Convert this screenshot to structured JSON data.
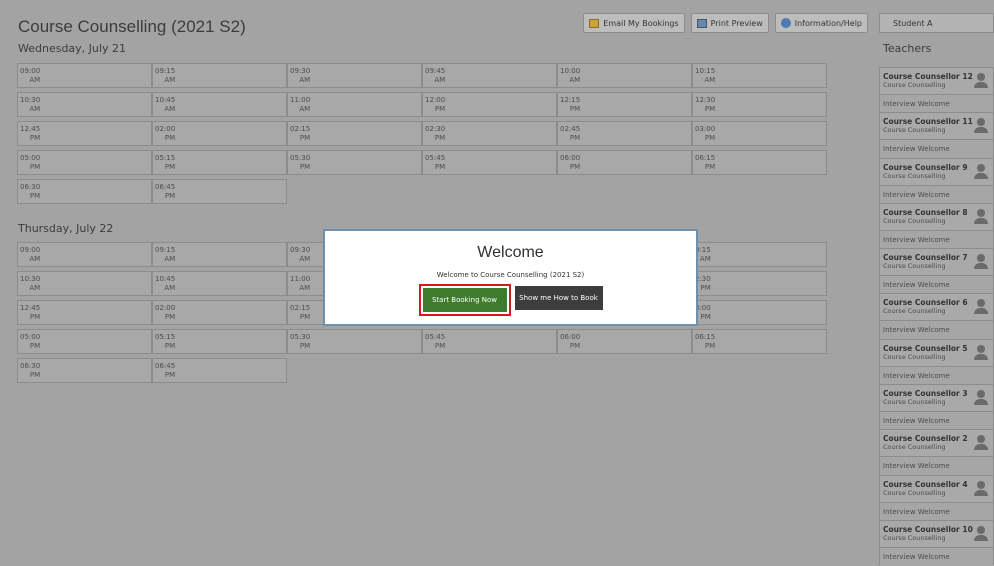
{
  "page": {
    "title": "Course Counselling (2021 S2)"
  },
  "toolbar": {
    "email_label": "Email My Bookings",
    "print_label": "Print Preview",
    "info_label": "Information/Help"
  },
  "user": {
    "name": "Student A"
  },
  "days": [
    {
      "heading": "Wednesday, July 21",
      "rows": [
        [
          {
            "t": "09:00",
            "p": "AM"
          },
          {
            "t": "09:15",
            "p": "AM"
          },
          {
            "t": "09:30",
            "p": "AM"
          },
          {
            "t": "09:45",
            "p": "AM"
          },
          {
            "t": "10:00",
            "p": "AM"
          },
          {
            "t": "10:15",
            "p": "AM"
          }
        ],
        [
          {
            "t": "10:30",
            "p": "AM"
          },
          {
            "t": "10:45",
            "p": "AM"
          },
          {
            "t": "11:00",
            "p": "AM"
          },
          {
            "t": "12:00",
            "p": "PM"
          },
          {
            "t": "12:15",
            "p": "PM"
          },
          {
            "t": "12:30",
            "p": "PM"
          }
        ],
        [
          {
            "t": "12:45",
            "p": "PM"
          },
          {
            "t": "02:00",
            "p": "PM"
          },
          {
            "t": "02:15",
            "p": "PM"
          },
          {
            "t": "02:30",
            "p": "PM"
          },
          {
            "t": "02:45",
            "p": "PM"
          },
          {
            "t": "03:00",
            "p": "PM"
          }
        ],
        [
          {
            "t": "05:00",
            "p": "PM"
          },
          {
            "t": "05:15",
            "p": "PM"
          },
          {
            "t": "05:30",
            "p": "PM"
          },
          {
            "t": "05:45",
            "p": "PM"
          },
          {
            "t": "06:00",
            "p": "PM"
          },
          {
            "t": "06:15",
            "p": "PM"
          }
        ],
        [
          {
            "t": "06:30",
            "p": "PM"
          },
          {
            "t": "06:45",
            "p": "PM"
          }
        ]
      ]
    },
    {
      "heading": "Thursday, July 22",
      "rows": [
        [
          {
            "t": "09:00",
            "p": "AM"
          },
          {
            "t": "09:15",
            "p": "AM"
          },
          {
            "t": "09:30",
            "p": "AM"
          },
          {
            "t": "",
            "p": ""
          },
          {
            "t": "",
            "p": ""
          },
          {
            "t": "0:15",
            "p": "AM"
          }
        ],
        [
          {
            "t": "10:30",
            "p": "AM"
          },
          {
            "t": "10:45",
            "p": "AM"
          },
          {
            "t": "11:00",
            "p": "AM"
          },
          {
            "t": "",
            "p": ""
          },
          {
            "t": "",
            "p": ""
          },
          {
            "t": "2:30",
            "p": "PM"
          }
        ],
        [
          {
            "t": "12:45",
            "p": "PM"
          },
          {
            "t": "02:00",
            "p": "PM"
          },
          {
            "t": "02:15",
            "p": "PM"
          },
          {
            "t": "",
            "p": ""
          },
          {
            "t": "",
            "p": ""
          },
          {
            "t": "3:00",
            "p": "PM"
          }
        ],
        [
          {
            "t": "05:00",
            "p": "PM"
          },
          {
            "t": "05:15",
            "p": "PM"
          },
          {
            "t": "05:30",
            "p": "PM"
          },
          {
            "t": "05:45",
            "p": "PM"
          },
          {
            "t": "06:00",
            "p": "PM"
          },
          {
            "t": "06:15",
            "p": "PM"
          }
        ],
        [
          {
            "t": "06:30",
            "p": "PM"
          },
          {
            "t": "06:45",
            "p": "PM"
          }
        ]
      ]
    }
  ],
  "modal": {
    "title": "Welcome",
    "text": "Welcome to Course Counselling (2021 S2)",
    "start_label": "Start Booking Now",
    "show_label": "Show me How to Book"
  },
  "sidebar": {
    "heading": "Teachers",
    "teachers": [
      {
        "name": "Course Counsellor 12",
        "subject": "Course Counselling",
        "status": "Interview Welcome"
      },
      {
        "name": "Course Counsellor 11",
        "subject": "Course Counselling",
        "status": "Interview Welcome"
      },
      {
        "name": "Course Counsellor 9",
        "subject": "Course Counselling",
        "status": "Interview Welcome"
      },
      {
        "name": "Course Counsellor 8",
        "subject": "Course Counselling",
        "status": "Interview Welcome"
      },
      {
        "name": "Course Counsellor 7",
        "subject": "Course Counselling",
        "status": "Interview Welcome"
      },
      {
        "name": "Course Counsellor 6",
        "subject": "Course Counselling",
        "status": "Interview Welcome"
      },
      {
        "name": "Course Counsellor 5",
        "subject": "Course Counselling",
        "status": "Interview Welcome"
      },
      {
        "name": "Course Counsellor 3",
        "subject": "Course Counselling",
        "status": "Interview Welcome"
      },
      {
        "name": "Course Counsellor 2",
        "subject": "Course Counselling",
        "status": "Interview Welcome"
      },
      {
        "name": "Course Counsellor 4",
        "subject": "Course Counselling",
        "status": "Interview Welcome"
      },
      {
        "name": "Course Counsellor 10",
        "subject": "Course Counselling",
        "status": "Interview Welcome"
      }
    ]
  }
}
